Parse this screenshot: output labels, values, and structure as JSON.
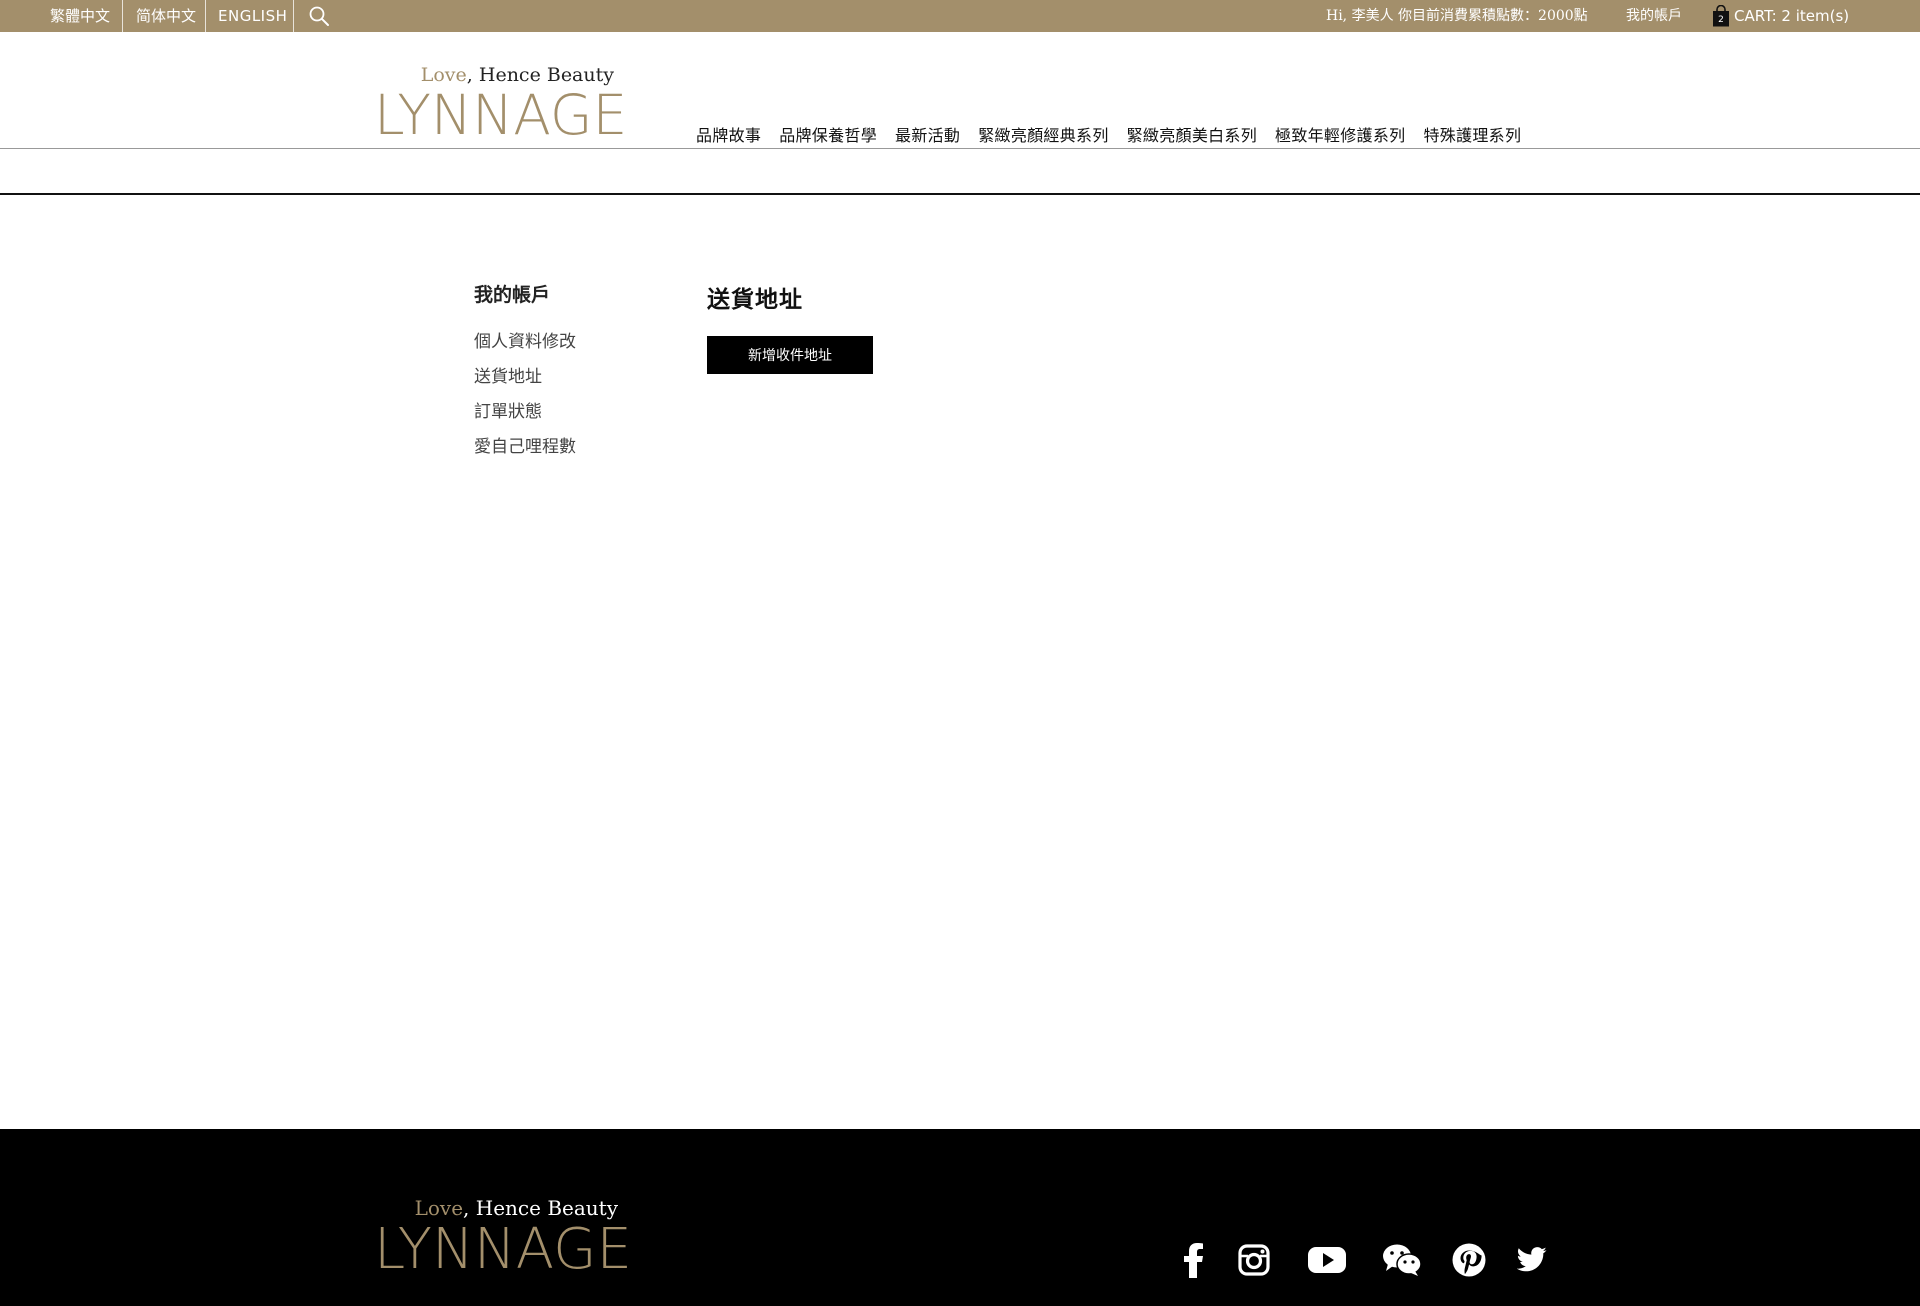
{
  "topbar": {
    "lang_tc": "繁體中文",
    "lang_sc": "简体中文",
    "lang_en": "ENGLISH",
    "greeting": "Hi, 李美人 你目前消費累積點數：2000點",
    "account": "我的帳戶",
    "cart_count": "2",
    "cart_label": "CART: 2 item(s)",
    "icons": [
      "search-icon",
      "shopping-bag-icon"
    ],
    "bg_color": "#a38f6b"
  },
  "brand": {
    "tagline_love": "Love",
    "tagline_rest": ", Hence Beauty",
    "wordmark": "LYNNAGE",
    "gold": "#a38f6b"
  },
  "nav": {
    "items": [
      "品牌故事",
      "品牌保養哲學",
      "最新活動",
      "緊緻亮顏經典系列",
      "緊緻亮顏美白系列",
      "極致年輕修護系列",
      "特殊護理系列"
    ]
  },
  "sidebar": {
    "title": "我的帳戶",
    "items": [
      "個人資料修改",
      "送貨地址",
      "訂單狀態",
      "愛自己哩程數"
    ]
  },
  "main": {
    "title": "送貨地址",
    "add_button": "新增收件地址"
  },
  "footer": {
    "social": [
      "facebook-icon",
      "instagram-icon",
      "youtube-icon",
      "wechat-icon",
      "pinterest-icon",
      "twitter-icon"
    ]
  }
}
